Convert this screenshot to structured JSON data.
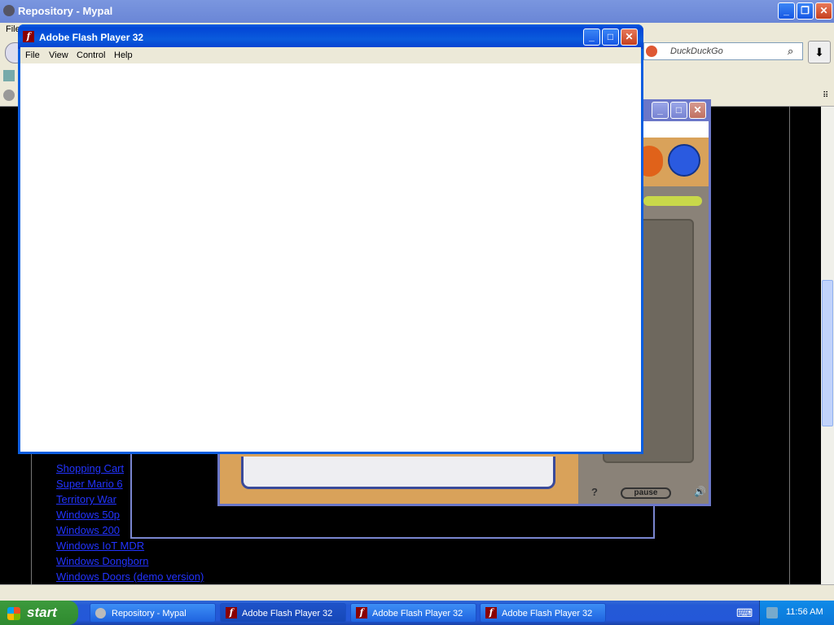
{
  "browser": {
    "title": "Repository - Mypal",
    "menu_first": "File",
    "search_placeholder": "DuckDuckGo"
  },
  "flash_window": {
    "title": "Adobe Flash Player 32",
    "menu": [
      "File",
      "View",
      "Control",
      "Help"
    ]
  },
  "game_window": {
    "pause_label": "pause",
    "help_glyph": "?"
  },
  "links": [
    "Shopping Cart",
    "Super Mario 6",
    "Territory War",
    "Windows 50p",
    "Windows 200",
    "Windows IoT MDR",
    "Windows Dongborn",
    "Windows Doors (demo version)"
  ],
  "taskbar": {
    "start_label": "start",
    "tasks": [
      "Repository - Mypal",
      "Adobe Flash Player 32",
      "Adobe Flash Player 32",
      "Adobe Flash Player 32"
    ],
    "clock": "11:56 AM"
  },
  "colors": {
    "xp_blue": "#0a5ee0",
    "link_blue": "#2233ff",
    "taskbar": "#2458d8",
    "start_green": "#3c9a3c"
  }
}
